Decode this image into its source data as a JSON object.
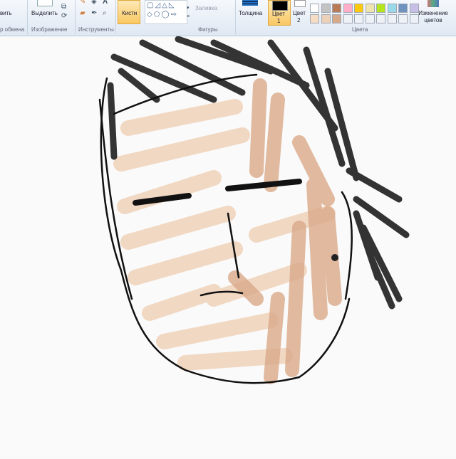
{
  "ribbon": {
    "clipboard": {
      "paste_partial": "вить",
      "group": "р обмена"
    },
    "image": {
      "select": "Выделить",
      "group": "Изображение"
    },
    "tools": {
      "group": "Инструменты"
    },
    "brushes": {
      "label": "Кисти"
    },
    "shapes": {
      "group": "Фигуры",
      "fill": "Заливка"
    },
    "size": {
      "label": "Толщина"
    },
    "color1": {
      "label": "Цвет",
      "num": "1",
      "color": "#000000"
    },
    "color2": {
      "label": "Цвет",
      "num": "2",
      "color": "#ffffff"
    },
    "colors": {
      "group": "Цвета",
      "edit": "Изменение цветов",
      "row2": [
        "#ffffff",
        "#c3c3c3",
        "#b97a57",
        "#ffaec9",
        "#ffc90e",
        "#efe4b0",
        "#b5e61d",
        "#99d9ea",
        "#7092be",
        "#c8bfe7"
      ],
      "row3": [
        "#f5dcc3",
        "#ecd0b8",
        "#d6a98a",
        "#eef2f7",
        "#eef2f7",
        "#eef2f7",
        "#eef2f7",
        "#eef2f7",
        "#eef2f7",
        "#eef2f7"
      ]
    }
  },
  "colors": {
    "hair": "#111111",
    "skin": "#f0d4bc",
    "shadow": "#d9a988"
  }
}
